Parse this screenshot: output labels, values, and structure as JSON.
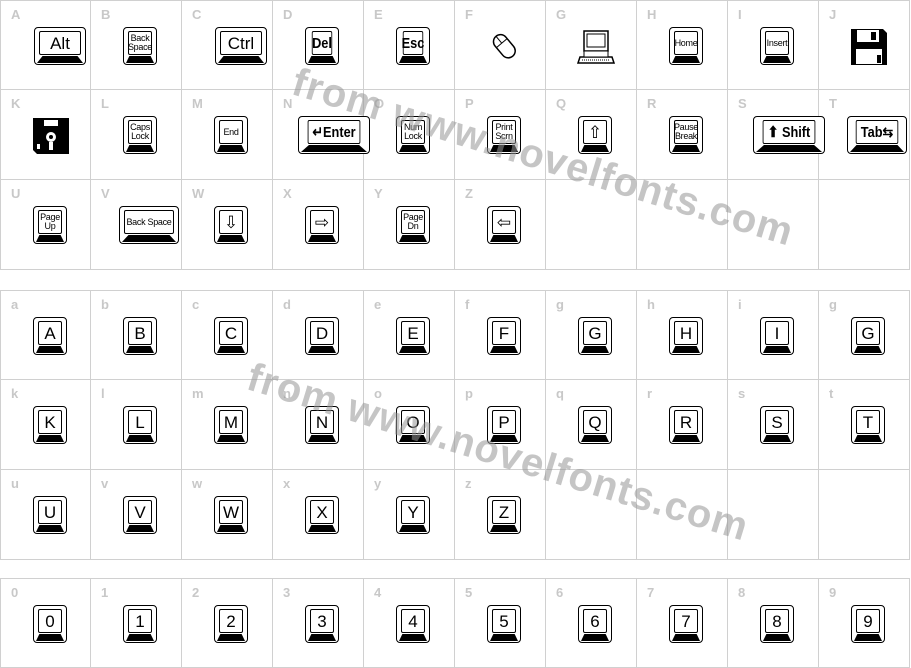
{
  "watermark": "from www.novelfonts.com",
  "sections": [
    [
      {
        "label": "A",
        "key": "Alt",
        "type": "wide"
      },
      {
        "label": "B",
        "key": "Back\nSpace",
        "type": "small"
      },
      {
        "label": "C",
        "key": "Ctrl",
        "type": "wide"
      },
      {
        "label": "D",
        "key": "Del",
        "type": "med"
      },
      {
        "label": "E",
        "key": "Esc",
        "type": "med"
      },
      {
        "label": "F",
        "icon": "mouse-icon"
      },
      {
        "label": "G",
        "icon": "computer-icon"
      },
      {
        "label": "H",
        "key": "Home",
        "type": "small"
      },
      {
        "label": "I",
        "key": "Insert",
        "type": "small"
      },
      {
        "label": "J",
        "icon": "floppy-disk-icon"
      },
      {
        "label": "K",
        "icon": "floppy-disk-back-icon"
      },
      {
        "label": "L",
        "key": "Caps\nLock",
        "type": "small"
      },
      {
        "label": "M",
        "key": "End",
        "type": "small"
      },
      {
        "label": "N",
        "key": "↵Enter",
        "type": "xwide"
      },
      {
        "label": "O",
        "key": "Num\nLock",
        "type": "small"
      },
      {
        "label": "P",
        "key": "Print\nScrn",
        "type": "small"
      },
      {
        "label": "Q",
        "key": "⇧",
        "type": "normal"
      },
      {
        "label": "R",
        "key": "Pause\nBreak",
        "type": "small"
      },
      {
        "label": "S",
        "key": "⬆ Shift",
        "type": "xwide"
      },
      {
        "label": "T",
        "key": "Tab⇆",
        "type": "mwide"
      },
      {
        "label": "U",
        "key": "Page\nUp",
        "type": "small"
      },
      {
        "label": "V",
        "key": "Back Space",
        "type": "mwides"
      },
      {
        "label": "W",
        "key": "⇩",
        "type": "normal"
      },
      {
        "label": "X",
        "key": "⇨",
        "type": "normal"
      },
      {
        "label": "Y",
        "key": "Page\nDn",
        "type": "small"
      },
      {
        "label": "Z",
        "key": "⇦",
        "type": "normal"
      },
      {},
      {},
      {},
      {}
    ],
    [
      {
        "label": "a",
        "key": "A"
      },
      {
        "label": "b",
        "key": "B"
      },
      {
        "label": "c",
        "key": "C"
      },
      {
        "label": "d",
        "key": "D"
      },
      {
        "label": "e",
        "key": "E"
      },
      {
        "label": "f",
        "key": "F"
      },
      {
        "label": "g",
        "key": "G"
      },
      {
        "label": "h",
        "key": "H"
      },
      {
        "label": "i",
        "key": "I"
      },
      {
        "label": "g",
        "key": "G"
      },
      {
        "label": "k",
        "key": "K"
      },
      {
        "label": "l",
        "key": "L"
      },
      {
        "label": "m",
        "key": "M"
      },
      {
        "label": "n",
        "key": "N"
      },
      {
        "label": "o",
        "key": "O"
      },
      {
        "label": "p",
        "key": "P"
      },
      {
        "label": "q",
        "key": "Q"
      },
      {
        "label": "r",
        "key": "R"
      },
      {
        "label": "s",
        "key": "S"
      },
      {
        "label": "t",
        "key": "T"
      },
      {
        "label": "u",
        "key": "U"
      },
      {
        "label": "v",
        "key": "V"
      },
      {
        "label": "w",
        "key": "W"
      },
      {
        "label": "x",
        "key": "X"
      },
      {
        "label": "y",
        "key": "Y"
      },
      {
        "label": "z",
        "key": "Z"
      },
      {},
      {},
      {},
      {}
    ],
    [
      {
        "label": "0",
        "key": "0"
      },
      {
        "label": "1",
        "key": "1"
      },
      {
        "label": "2",
        "key": "2"
      },
      {
        "label": "3",
        "key": "3"
      },
      {
        "label": "4",
        "key": "4"
      },
      {
        "label": "5",
        "key": "5"
      },
      {
        "label": "6",
        "key": "6"
      },
      {
        "label": "7",
        "key": "7"
      },
      {
        "label": "8",
        "key": "8"
      },
      {
        "label": "9",
        "key": "9"
      }
    ]
  ]
}
